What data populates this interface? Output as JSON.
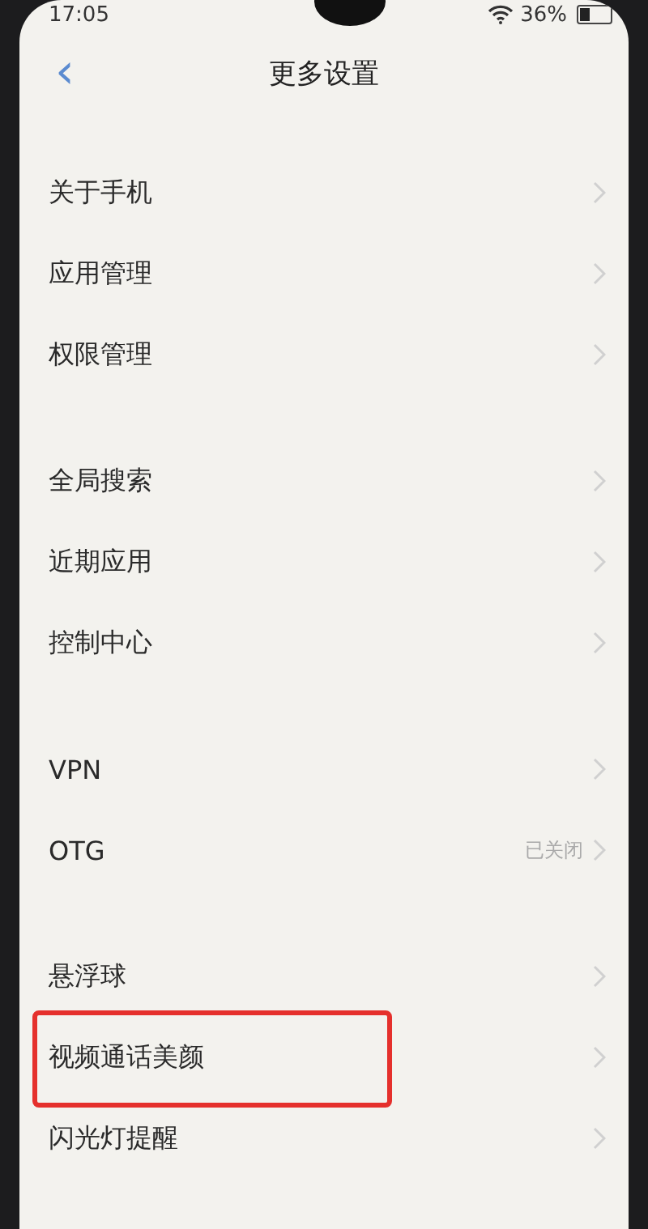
{
  "status_bar": {
    "time": "17:05",
    "battery_text": "36%"
  },
  "header": {
    "back": "‹",
    "title": "更多设置"
  },
  "groups": [
    {
      "items": [
        {
          "label": "关于手机",
          "highlighted": false
        },
        {
          "label": "应用管理",
          "highlighted": false
        },
        {
          "label": "权限管理",
          "highlighted": false
        }
      ]
    },
    {
      "items": [
        {
          "label": "全局搜索",
          "highlighted": false
        },
        {
          "label": "近期应用",
          "highlighted": false
        },
        {
          "label": "控制中心",
          "highlighted": false
        }
      ]
    },
    {
      "items": [
        {
          "label": "VPN",
          "highlighted": false
        },
        {
          "label": "OTG",
          "value": "已关闭",
          "highlighted": false
        }
      ]
    },
    {
      "items": [
        {
          "label": "悬浮球",
          "highlighted": false
        },
        {
          "label": "视频通话美颜",
          "highlighted": true
        },
        {
          "label": "闪光灯提醒",
          "highlighted": false
        }
      ]
    }
  ]
}
